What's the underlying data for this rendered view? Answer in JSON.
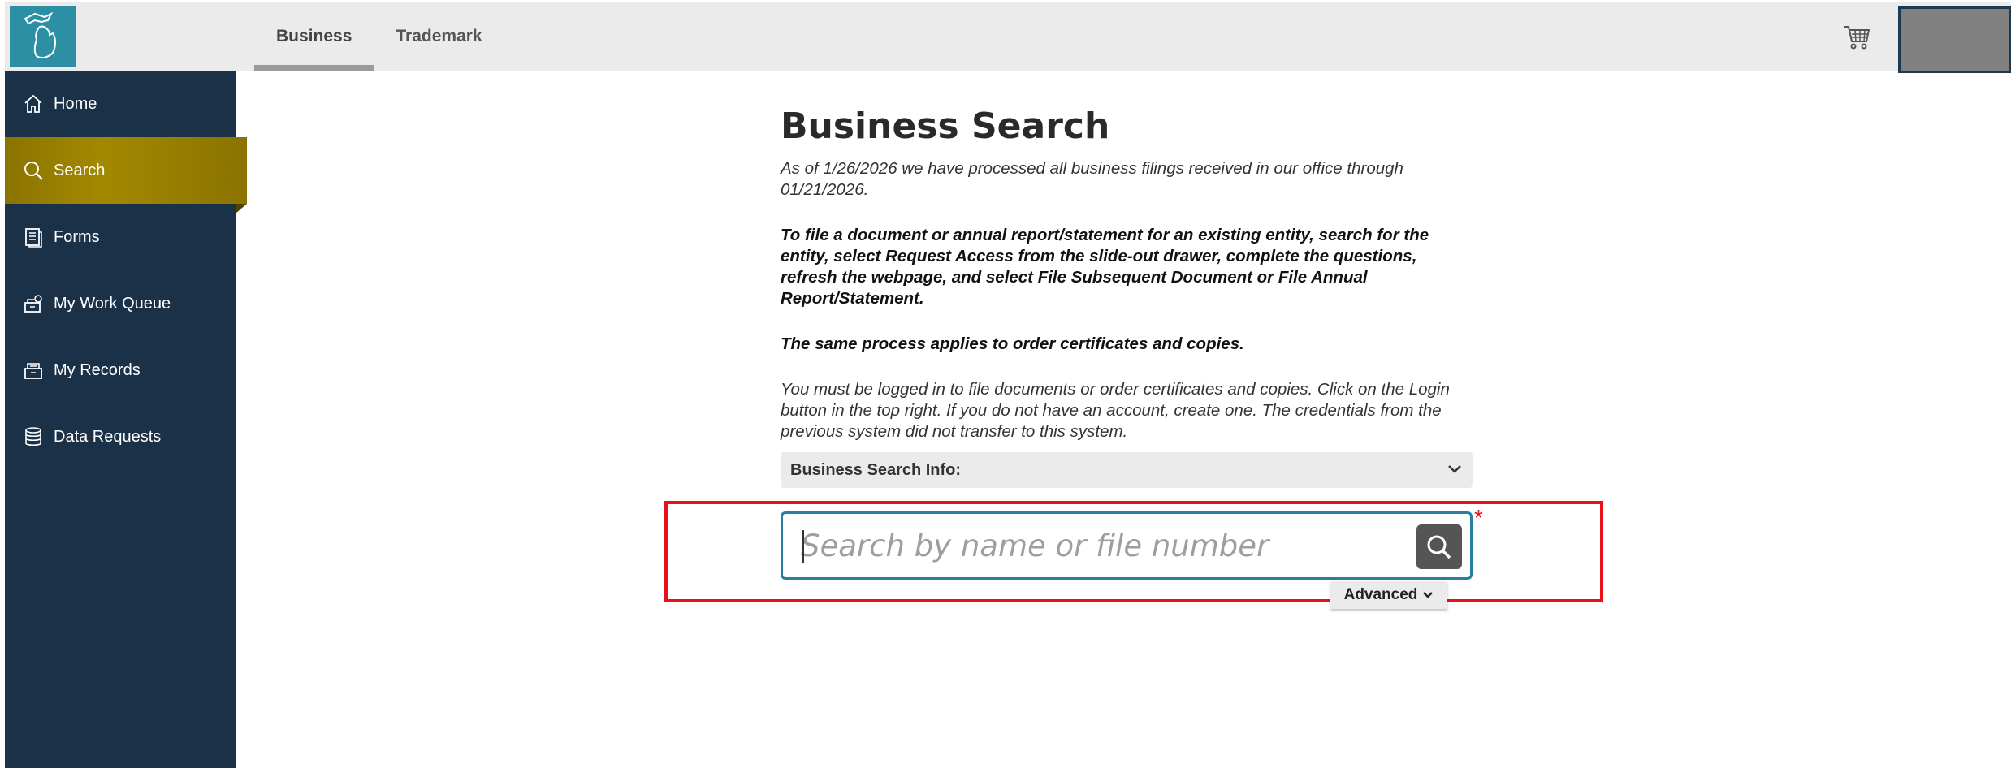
{
  "header": {
    "tabs": [
      {
        "label": "Business",
        "active": true
      },
      {
        "label": "Trademark",
        "active": false
      }
    ],
    "cart_icon": "cart-icon",
    "logo_icon": "michigan-logo-icon"
  },
  "sidebar": {
    "items": [
      {
        "label": "Home",
        "icon": "home-icon"
      },
      {
        "label": "Search",
        "icon": "search-icon",
        "active": true
      },
      {
        "label": "Forms",
        "icon": "forms-icon"
      },
      {
        "label": "My Work Queue",
        "icon": "work-queue-icon"
      },
      {
        "label": "My Records",
        "icon": "records-icon"
      },
      {
        "label": "Data Requests",
        "icon": "database-icon"
      }
    ]
  },
  "main": {
    "title": "Business Search",
    "processed_note": "As of 1/26/2026 we have processed all business filings received in our office through 01/21/2026.",
    "instructions": "To file a document or annual report/statement for an existing entity, search for the entity, select Request Access from the slide-out drawer, complete the questions, refresh the webpage, and select File Subsequent Document or File Annual Report/Statement.",
    "same_process": "The same process applies to order certificates and copies.",
    "login_note": "You must be logged in to file documents or order certificates and copies. Click on the Login button in the top right. If you do not have an account, create one. The credentials from the previous system did not transfer to this system.",
    "info_bar_label": "Business Search Info:",
    "search": {
      "placeholder": "Search by name or file number",
      "value": "",
      "required_mark": "*"
    },
    "advanced_label": "Advanced"
  },
  "colors": {
    "sidebar_bg": "#1b3147",
    "active_nav": "#a38900",
    "logo_bg": "#2c8fa3",
    "search_border": "#2a7fa0",
    "highlight": "#e8101a"
  }
}
